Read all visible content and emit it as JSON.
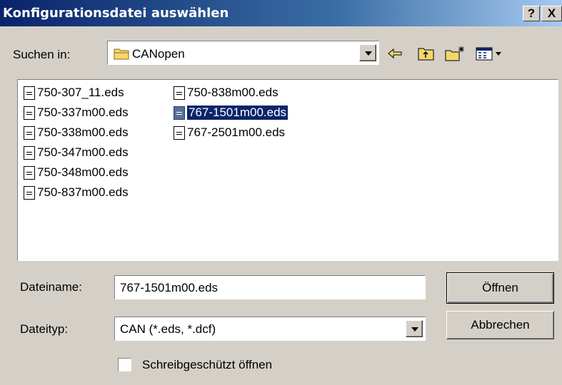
{
  "window": {
    "title": "Konfigurationsdatei auswählen",
    "help_label": "?",
    "close_label": "X"
  },
  "lookin": {
    "label": "Suchen in:",
    "value": "CANopen"
  },
  "toolbar": {
    "icons": [
      "back-arrow-icon",
      "up-folder-icon",
      "new-folder-icon",
      "view-menu-icon"
    ]
  },
  "files": {
    "col1": [
      "750-307_11.eds",
      "750-337m00.eds",
      "750-338m00.eds",
      "750-347m00.eds",
      "750-348m00.eds",
      "750-837m00.eds"
    ],
    "col2": [
      "750-838m00.eds",
      "767-1501m00.eds",
      "767-2501m00.eds"
    ],
    "selected": "767-1501m00.eds"
  },
  "filename": {
    "label": "Dateiname:",
    "value": "767-1501m00.eds"
  },
  "filetype": {
    "label": "Dateityp:",
    "value": "CAN (*.eds, *.dcf)"
  },
  "buttons": {
    "open": "Öffnen",
    "cancel": "Abbrechen"
  },
  "readonly": {
    "label": "Schreibgeschützt öffnen",
    "checked": false
  },
  "colors": {
    "title_bar": "#0a246a",
    "selection": "#0a246a",
    "face": "#d4d0c8",
    "folder": "#f5d76e"
  }
}
